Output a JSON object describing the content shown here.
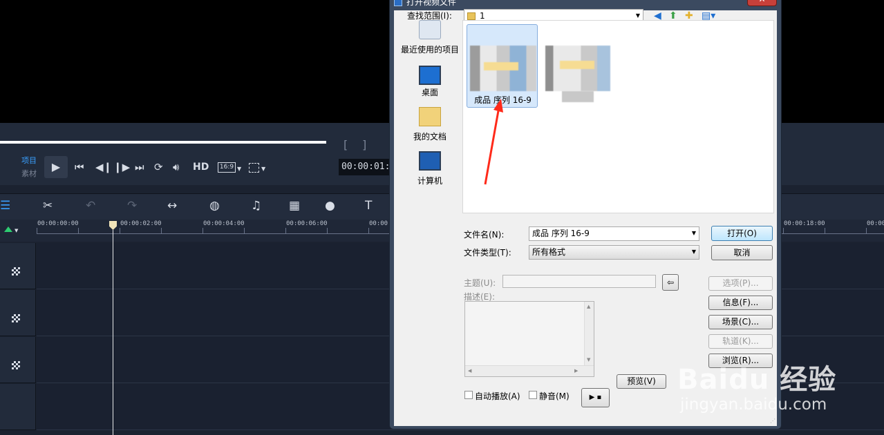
{
  "editor": {
    "mode_project": "项目",
    "mode_clip": "素材",
    "hd_label": "HD",
    "aspect_ratio": "16:9",
    "timecode": "00:00:01:0",
    "bracket_in": "[",
    "bracket_out": "]",
    "ruler_labels": [
      "00:00:00:00",
      "00:00:02:00",
      "00:00:04:00",
      "00:00:06:00",
      "00:00",
      "00:00:18:00",
      "00:00"
    ]
  },
  "dialog": {
    "title": "打开视频文件",
    "close_label": "✕",
    "lookin_label": "查找范围(I):",
    "lookin_value": "1",
    "places": [
      {
        "label": "最近使用的项目",
        "icon": "recent-items-icon"
      },
      {
        "label": "桌面",
        "icon": "desktop-icon"
      },
      {
        "label": "我的文档",
        "icon": "documents-folder-icon"
      },
      {
        "label": "计算机",
        "icon": "computer-icon"
      }
    ],
    "files": [
      {
        "label": "成品 序列 16-9",
        "selected": true
      },
      {
        "label": "",
        "selected": false
      }
    ],
    "filename_label": "文件名(N):",
    "filename_value": "成品 序列 16-9",
    "filetype_label": "文件类型(T):",
    "filetype_value": "所有格式",
    "open_button": "打开(O)",
    "cancel_button": "取消",
    "subject_label": "主题(U):",
    "description_label": "描述(E):",
    "options_button": "选项(P)...",
    "info_button": "信息(F)...",
    "scene_button": "场景(C)...",
    "track_button": "轨道(K)...",
    "browse_button": "浏览(R)...",
    "preview_button": "预览(V)",
    "autoplay_label": "自动播放(A)",
    "mute_label": "静音(M)",
    "play_button": "▶ ▪"
  },
  "watermark": {
    "main": "Baidu 经验",
    "sub": "jingyan.baidu.com"
  },
  "colors": {
    "accent": "#3aa0ff",
    "annotation_arrow": "#ff2a1a",
    "dialog_frame": "#3b4a60"
  }
}
